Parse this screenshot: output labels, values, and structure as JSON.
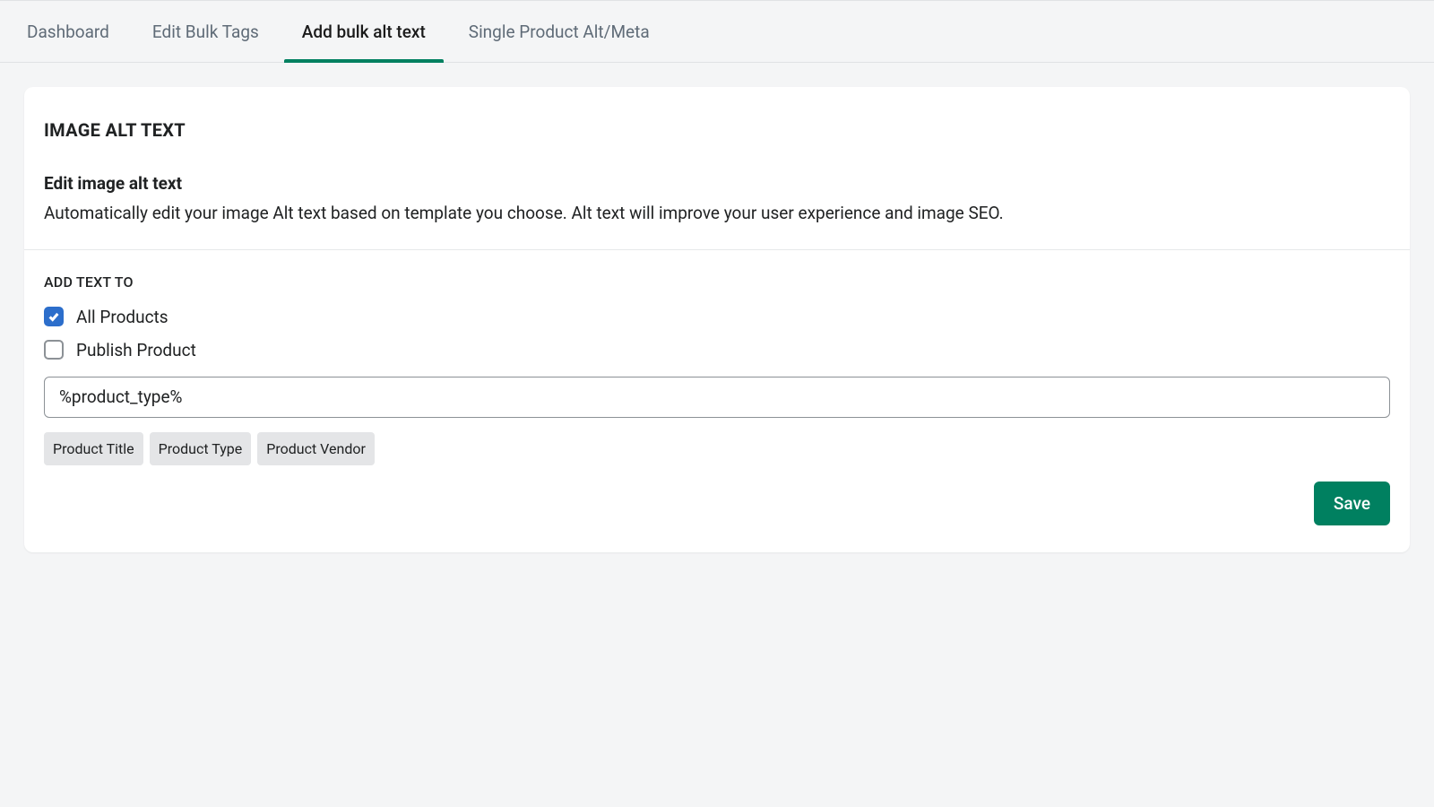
{
  "tabs": [
    {
      "label": "Dashboard",
      "active": false
    },
    {
      "label": "Edit Bulk Tags",
      "active": false
    },
    {
      "label": "Add bulk alt text",
      "active": true
    },
    {
      "label": "Single Product Alt/Meta",
      "active": false
    }
  ],
  "card": {
    "title": "IMAGE ALT TEXT",
    "subtitle": "Edit image alt text",
    "description": "Automatically edit your image Alt text based on template you choose. Alt text will improve your user experience and image SEO."
  },
  "section": {
    "label": "ADD TEXT TO",
    "checkboxes": [
      {
        "label": "All Products",
        "checked": true
      },
      {
        "label": "Publish Product",
        "checked": false
      }
    ],
    "input_value": "%product_type%",
    "tokens": [
      "Product Title",
      "Product Type",
      "Product Vendor"
    ]
  },
  "actions": {
    "save_label": "Save"
  }
}
